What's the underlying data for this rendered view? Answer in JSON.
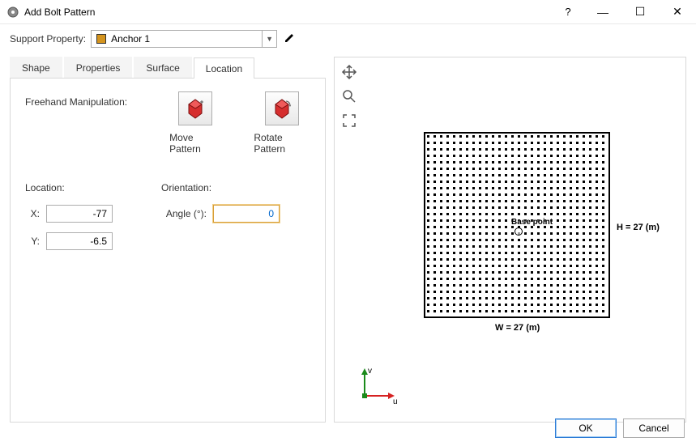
{
  "window": {
    "title": "Add Bolt Pattern",
    "help": "?",
    "min": "—",
    "max": "☐",
    "close": "✕"
  },
  "support": {
    "label": "Support Property:",
    "value": "Anchor 1",
    "swatch_color": "#d4941e"
  },
  "tabs": {
    "items": [
      {
        "label": "Shape"
      },
      {
        "label": "Properties"
      },
      {
        "label": "Surface"
      },
      {
        "label": "Location"
      }
    ],
    "active_index": 3
  },
  "panel": {
    "freehand_label": "Freehand Manipulation:",
    "move_caption": "Move Pattern",
    "rotate_caption": "Rotate Pattern",
    "location_header": "Location:",
    "orientation_header": "Orientation:",
    "x_label": "X:",
    "y_label": "Y:",
    "angle_label": "Angle (°):",
    "x_value": "-77",
    "y_value": "-6.5",
    "angle_value": "0"
  },
  "preview": {
    "basepoint_label": "Base point",
    "h_label": "H = 27 (m)",
    "w_label": "W = 27 (m)",
    "v_axis": "v",
    "u_axis": "u"
  },
  "buttons": {
    "ok": "OK",
    "cancel": "Cancel"
  }
}
